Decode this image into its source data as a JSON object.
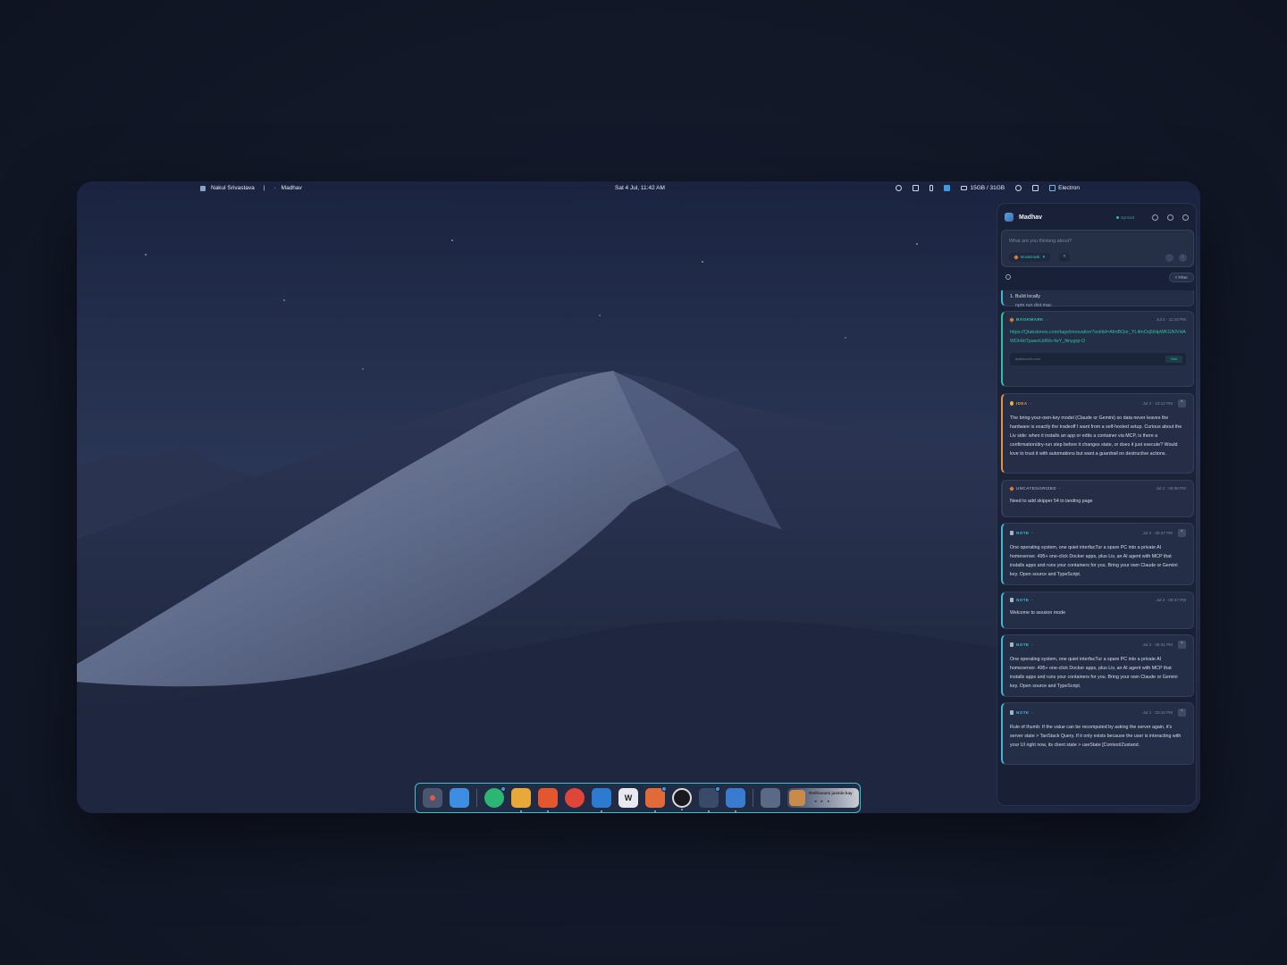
{
  "topbar": {
    "user_name": "Nakul Srivastava",
    "separator": "|",
    "workspace_name": "Madhav",
    "datetime": "Sat 4 Jul, 11:42 AM",
    "memory": "15GB / 31GB",
    "active_app": "Electron"
  },
  "panel": {
    "title": "Madhav",
    "sync_status": "Synced",
    "composer": {
      "placeholder": "What are you thinking about?",
      "type_button": "Bookmark",
      "hash_button": "#"
    },
    "filter_label": "Filter",
    "partial_card": {
      "line1": "1. Build locally",
      "line2": "npm run dist:mac"
    },
    "cards": [
      {
        "type": "BOOKMARK",
        "date": "Jul 2 · 11:10 PM",
        "link": "https://Qtakstones.com/tags/innovation?srsltid=AfmBOor_YL4mOq5IHpWKGNIVHAWDHHiTpawxUdWs-fwY_fiinygrp-O",
        "preview_domain": "qtakstones.com",
        "visit_label": "Visit"
      },
      {
        "type": "IDEA",
        "date": "Jul 2 · 10:12 PM",
        "body": "The bring-your-own-key model (Claude or Gemini) so data never leaves the hardware is exactly the tradeoff I want from a self-hosted setup. Curious about the Liv side: when it installs an app or edits a container via MCP, is there a confirmation/dry-run step before it changes state, or does it just execute? Would love to trust it with automations but want a guardrail on destructive actions."
      },
      {
        "type": "UNCATEGORIZED",
        "date": "Jul 2 · 09:38 PM",
        "body": "Need to add skipper 54 to landing page"
      },
      {
        "type": "NOTE",
        "date": "Jul 2 · 09:37 PM",
        "body": "One operating system, one quiet interfacTur a spare PC into a private AI homeserver. 495+ one-click Docker apps, plus Liv, an AI agent with MCP that installs apps and runs your containers for you. Bring your own Claude or Gemini key. Open source and TypeScript."
      },
      {
        "type": "NOTE",
        "date": "Jul 2 · 09:37 PM",
        "body": "Welcome to session mode"
      },
      {
        "type": "NOTE",
        "date": "Jul 2 · 08:31 PM",
        "body": "One operating system, one quiet interfacTur a spare PC into a private AI homeserver. 495+ one-click Docker apps, plus Liv, an AI agent with MCP that installs apps and runs your containers for you. Bring your own Claude or Gemini key. Open source and TypeScript."
      },
      {
        "type": "NOTE",
        "date": "Jul 1 · 03:43 PM",
        "body": "Rule of thumb: If the value can be recomputed by asking the server again, it's server state > TanStack Query. If it only exists because the user is interacting with your UI right now, its client state > useState [Context/Zustand."
      }
    ]
  },
  "dock": {
    "media_title": "Redhanami jasmin kay"
  },
  "colors": {
    "accent": "#3fc2cf",
    "note": "#3fb9d0",
    "bookmark": "#2cc2a5",
    "idea": "#e8913a"
  }
}
